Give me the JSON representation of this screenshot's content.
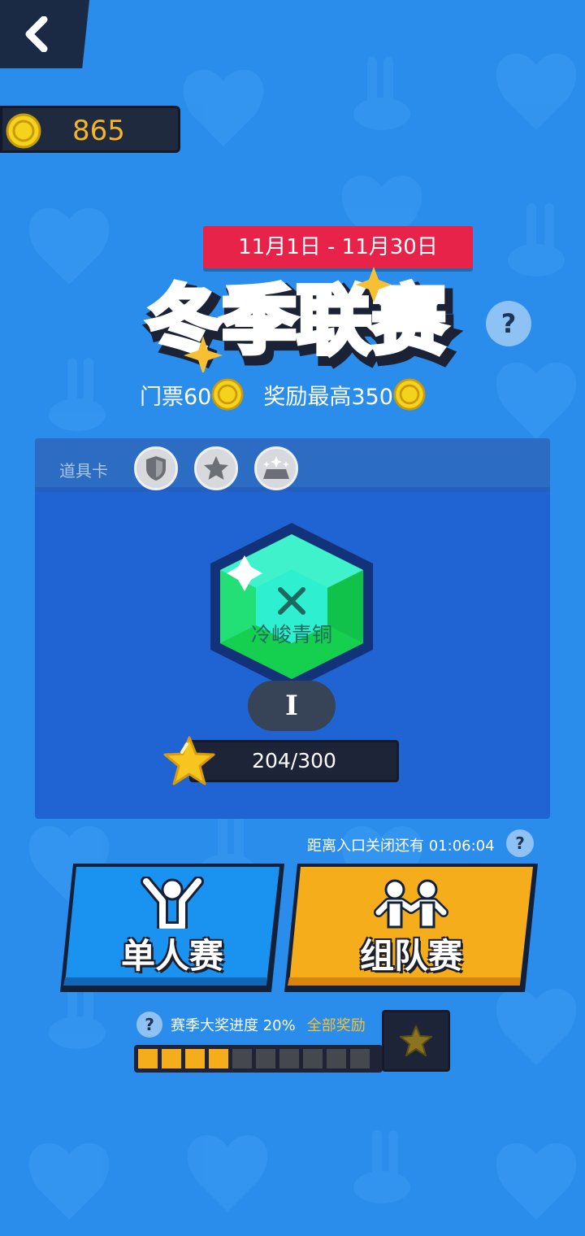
{
  "header": {
    "back_icon": "chevron-left-icon",
    "coins": "865"
  },
  "event": {
    "date_range": "11月1日 - 11月30日",
    "title": "冬季联赛",
    "help": "?",
    "ticket_label": "门票60",
    "reward_label": "奖励最高350"
  },
  "panel": {
    "props_label": "道具卡",
    "props": [
      "shield-icon",
      "star-icon",
      "sparkle-box-icon"
    ],
    "rank_name": "冷峻青铜",
    "rank_level": "I",
    "star_progress": "204/300",
    "star_progress_value": 0.68
  },
  "entry": {
    "countdown": "距离入口关闭还有 01:06:04",
    "help": "?"
  },
  "modes": {
    "solo_label": "单人赛",
    "team_label": "组队赛"
  },
  "season": {
    "help": "?",
    "progress_label": "赛季大奖进度 20%",
    "all_rewards_label": "全部奖励",
    "progress_value": 0.2,
    "segments_total": 10,
    "segments_filled": 4
  },
  "colors": {
    "background": "#2a8ceb",
    "banner_red": "#e8234a",
    "coin_gold": "#f6b526",
    "solo_blue": "#1a93f0",
    "team_orange": "#f6ad1b"
  }
}
